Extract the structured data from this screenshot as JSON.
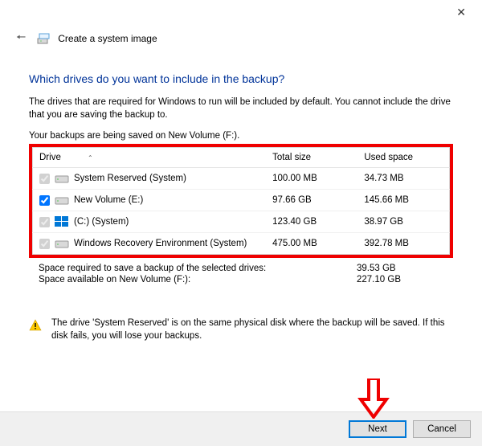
{
  "window": {
    "title": "Create a system image"
  },
  "page": {
    "heading": "Which drives do you want to include in the backup?",
    "description": "The drives that are required for Windows to run will be included by default. You cannot include the drive that you are saving the backup to.",
    "saving_note": "Your backups are being saved on New Volume (F:)."
  },
  "table": {
    "columns": {
      "drive": "Drive",
      "total": "Total size",
      "used": "Used space"
    },
    "rows": [
      {
        "checked": true,
        "disabled": true,
        "icon": "drive",
        "name": "System Reserved (System)",
        "total": "100.00 MB",
        "used": "34.73 MB"
      },
      {
        "checked": true,
        "disabled": false,
        "icon": "drive",
        "name": "New Volume (E:)",
        "total": "97.66 GB",
        "used": "145.66 MB"
      },
      {
        "checked": true,
        "disabled": true,
        "icon": "windows",
        "name": "(C:) (System)",
        "total": "123.40 GB",
        "used": "38.97 GB"
      },
      {
        "checked": true,
        "disabled": true,
        "icon": "drive",
        "name": "Windows Recovery Environment (System)",
        "total": "475.00 MB",
        "used": "392.78 MB"
      }
    ]
  },
  "summary": {
    "required_label": "Space required to save a backup of the selected drives:",
    "required_value": "39.53 GB",
    "available_label": "Space available on New Volume (F:):",
    "available_value": "227.10 GB"
  },
  "warning": {
    "text": "The drive 'System Reserved' is on the same physical disk where the backup will be saved. If this disk fails, you will lose your backups."
  },
  "buttons": {
    "next": "Next",
    "cancel": "Cancel"
  }
}
